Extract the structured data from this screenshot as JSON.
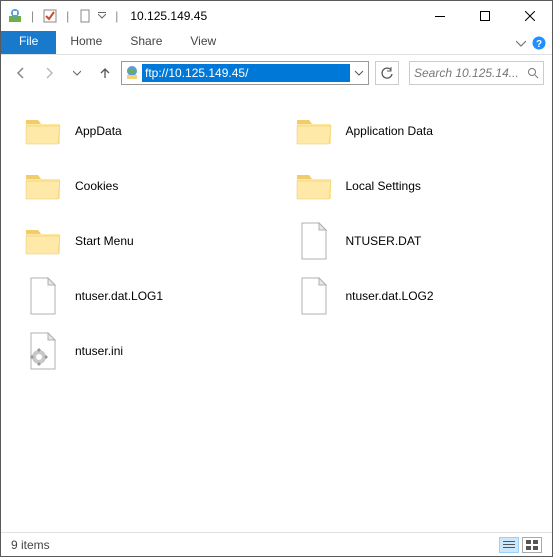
{
  "window": {
    "title": "10.125.149.45"
  },
  "ribbon": {
    "file": "File",
    "home": "Home",
    "share": "Share",
    "view": "View"
  },
  "address": {
    "value": "ftp://10.125.149.45/"
  },
  "search": {
    "placeholder": "Search 10.125.14..."
  },
  "items": [
    {
      "name": "AppData",
      "type": "folder"
    },
    {
      "name": "Application Data",
      "type": "folder"
    },
    {
      "name": "Cookies",
      "type": "folder"
    },
    {
      "name": "Local Settings",
      "type": "folder"
    },
    {
      "name": "Start Menu",
      "type": "folder"
    },
    {
      "name": "NTUSER.DAT",
      "type": "file"
    },
    {
      "name": "ntuser.dat.LOG1",
      "type": "file"
    },
    {
      "name": "ntuser.dat.LOG2",
      "type": "file"
    },
    {
      "name": "ntuser.ini",
      "type": "ini"
    }
  ],
  "status": {
    "count": "9 items"
  }
}
